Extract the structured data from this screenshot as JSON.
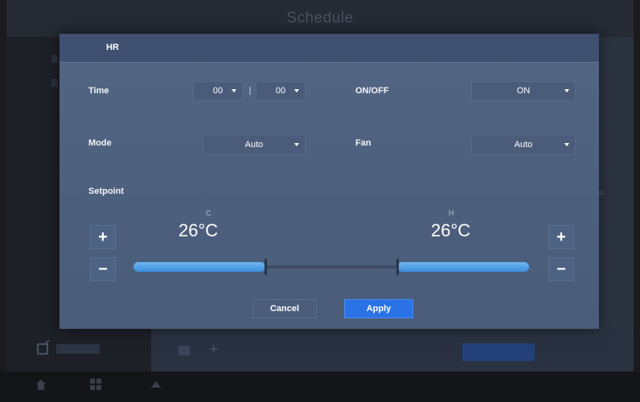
{
  "background": {
    "title": "Schedule"
  },
  "dialog": {
    "title": "HR",
    "time": {
      "label": "Time",
      "hour": "00",
      "minute": "00"
    },
    "onoff": {
      "label": "ON/OFF",
      "value": "ON"
    },
    "mode": {
      "label": "Mode",
      "value": "Auto"
    },
    "fan": {
      "label": "Fan",
      "value": "Auto"
    },
    "setpoint": {
      "label": "Setpoint",
      "cool": {
        "caption": "C",
        "value": "26°C",
        "plus": "+",
        "minus": "−"
      },
      "heat": {
        "caption": "H",
        "value": "26°C",
        "plus": "+",
        "minus": "−"
      }
    },
    "buttons": {
      "cancel": "Cancel",
      "apply": "Apply"
    }
  },
  "colors": {
    "accent": "#2a72e6",
    "slider": "#4a9be6",
    "dialog_bg": "#4c5f7c"
  }
}
